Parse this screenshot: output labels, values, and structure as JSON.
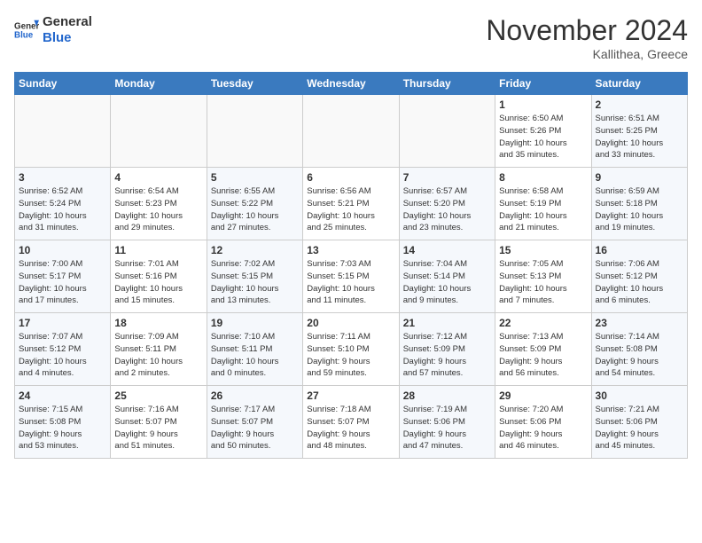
{
  "header": {
    "logo_line1": "General",
    "logo_line2": "Blue",
    "month": "November 2024",
    "location": "Kallithea, Greece"
  },
  "weekdays": [
    "Sunday",
    "Monday",
    "Tuesday",
    "Wednesday",
    "Thursday",
    "Friday",
    "Saturday"
  ],
  "weeks": [
    [
      {
        "day": "",
        "info": ""
      },
      {
        "day": "",
        "info": ""
      },
      {
        "day": "",
        "info": ""
      },
      {
        "day": "",
        "info": ""
      },
      {
        "day": "",
        "info": ""
      },
      {
        "day": "1",
        "info": "Sunrise: 6:50 AM\nSunset: 5:26 PM\nDaylight: 10 hours\nand 35 minutes."
      },
      {
        "day": "2",
        "info": "Sunrise: 6:51 AM\nSunset: 5:25 PM\nDaylight: 10 hours\nand 33 minutes."
      }
    ],
    [
      {
        "day": "3",
        "info": "Sunrise: 6:52 AM\nSunset: 5:24 PM\nDaylight: 10 hours\nand 31 minutes."
      },
      {
        "day": "4",
        "info": "Sunrise: 6:54 AM\nSunset: 5:23 PM\nDaylight: 10 hours\nand 29 minutes."
      },
      {
        "day": "5",
        "info": "Sunrise: 6:55 AM\nSunset: 5:22 PM\nDaylight: 10 hours\nand 27 minutes."
      },
      {
        "day": "6",
        "info": "Sunrise: 6:56 AM\nSunset: 5:21 PM\nDaylight: 10 hours\nand 25 minutes."
      },
      {
        "day": "7",
        "info": "Sunrise: 6:57 AM\nSunset: 5:20 PM\nDaylight: 10 hours\nand 23 minutes."
      },
      {
        "day": "8",
        "info": "Sunrise: 6:58 AM\nSunset: 5:19 PM\nDaylight: 10 hours\nand 21 minutes."
      },
      {
        "day": "9",
        "info": "Sunrise: 6:59 AM\nSunset: 5:18 PM\nDaylight: 10 hours\nand 19 minutes."
      }
    ],
    [
      {
        "day": "10",
        "info": "Sunrise: 7:00 AM\nSunset: 5:17 PM\nDaylight: 10 hours\nand 17 minutes."
      },
      {
        "day": "11",
        "info": "Sunrise: 7:01 AM\nSunset: 5:16 PM\nDaylight: 10 hours\nand 15 minutes."
      },
      {
        "day": "12",
        "info": "Sunrise: 7:02 AM\nSunset: 5:15 PM\nDaylight: 10 hours\nand 13 minutes."
      },
      {
        "day": "13",
        "info": "Sunrise: 7:03 AM\nSunset: 5:15 PM\nDaylight: 10 hours\nand 11 minutes."
      },
      {
        "day": "14",
        "info": "Sunrise: 7:04 AM\nSunset: 5:14 PM\nDaylight: 10 hours\nand 9 minutes."
      },
      {
        "day": "15",
        "info": "Sunrise: 7:05 AM\nSunset: 5:13 PM\nDaylight: 10 hours\nand 7 minutes."
      },
      {
        "day": "16",
        "info": "Sunrise: 7:06 AM\nSunset: 5:12 PM\nDaylight: 10 hours\nand 6 minutes."
      }
    ],
    [
      {
        "day": "17",
        "info": "Sunrise: 7:07 AM\nSunset: 5:12 PM\nDaylight: 10 hours\nand 4 minutes."
      },
      {
        "day": "18",
        "info": "Sunrise: 7:09 AM\nSunset: 5:11 PM\nDaylight: 10 hours\nand 2 minutes."
      },
      {
        "day": "19",
        "info": "Sunrise: 7:10 AM\nSunset: 5:11 PM\nDaylight: 10 hours\nand 0 minutes."
      },
      {
        "day": "20",
        "info": "Sunrise: 7:11 AM\nSunset: 5:10 PM\nDaylight: 9 hours\nand 59 minutes."
      },
      {
        "day": "21",
        "info": "Sunrise: 7:12 AM\nSunset: 5:09 PM\nDaylight: 9 hours\nand 57 minutes."
      },
      {
        "day": "22",
        "info": "Sunrise: 7:13 AM\nSunset: 5:09 PM\nDaylight: 9 hours\nand 56 minutes."
      },
      {
        "day": "23",
        "info": "Sunrise: 7:14 AM\nSunset: 5:08 PM\nDaylight: 9 hours\nand 54 minutes."
      }
    ],
    [
      {
        "day": "24",
        "info": "Sunrise: 7:15 AM\nSunset: 5:08 PM\nDaylight: 9 hours\nand 53 minutes."
      },
      {
        "day": "25",
        "info": "Sunrise: 7:16 AM\nSunset: 5:07 PM\nDaylight: 9 hours\nand 51 minutes."
      },
      {
        "day": "26",
        "info": "Sunrise: 7:17 AM\nSunset: 5:07 PM\nDaylight: 9 hours\nand 50 minutes."
      },
      {
        "day": "27",
        "info": "Sunrise: 7:18 AM\nSunset: 5:07 PM\nDaylight: 9 hours\nand 48 minutes."
      },
      {
        "day": "28",
        "info": "Sunrise: 7:19 AM\nSunset: 5:06 PM\nDaylight: 9 hours\nand 47 minutes."
      },
      {
        "day": "29",
        "info": "Sunrise: 7:20 AM\nSunset: 5:06 PM\nDaylight: 9 hours\nand 46 minutes."
      },
      {
        "day": "30",
        "info": "Sunrise: 7:21 AM\nSunset: 5:06 PM\nDaylight: 9 hours\nand 45 minutes."
      }
    ]
  ]
}
